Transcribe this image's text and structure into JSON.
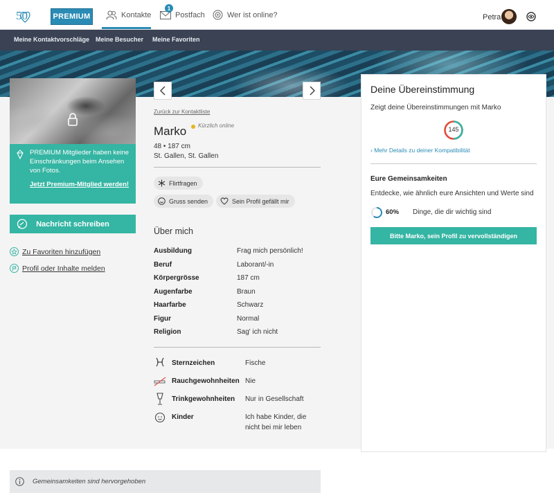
{
  "header": {
    "logo_text": "50",
    "premium_label": "PREMIUM",
    "tabs": [
      {
        "label": "Kontakte",
        "icon": "contacts-icon"
      },
      {
        "label": "Postfach",
        "icon": "mail-icon",
        "badge": "1"
      },
      {
        "label": "Wer ist online?",
        "icon": "online-icon"
      }
    ],
    "user_name": "Petra"
  },
  "subnav": {
    "items": [
      "Meine Kontaktvorschläge",
      "Meine Besucher",
      "Meine Favoriten"
    ]
  },
  "left": {
    "premium_text": "PREMIUM Mitglieder haben keine Einschränkungen beim Ansehen von Fotos.",
    "premium_link": "Jetzt Premium-Mitglied werden!",
    "message_button": "Nachricht schreiben",
    "favorites_link": "Zu Favoriten hinzufügen",
    "report_link": "Profil oder Inhalte melden"
  },
  "profile": {
    "back_link": "Zurück zur Kontaktliste",
    "name": "Marko",
    "online_status": "Kürzlich online",
    "age_height": "48 • 187 cm",
    "location": "St. Gallen, St. Gallen",
    "chips": {
      "flirt": "Flirtfragen",
      "greet": "Gruss senden",
      "like": "Sein Profil gefällt mir"
    },
    "about_title": "Über mich",
    "attributes": [
      {
        "key": "Ausbildung",
        "value": "Frag mich persönlich!"
      },
      {
        "key": "Beruf",
        "value": "Laborant/-in"
      },
      {
        "key": "Körpergrösse",
        "value": "187 cm"
      },
      {
        "key": "Augenfarbe",
        "value": "Braun"
      },
      {
        "key": "Haarfarbe",
        "value": "Schwarz"
      },
      {
        "key": "Figur",
        "value": "Normal"
      },
      {
        "key": "Religion",
        "value": "Sag' ich nicht"
      }
    ],
    "habits": [
      {
        "key": "Sternzeichen",
        "value": "Fische",
        "icon": "pisces-icon"
      },
      {
        "key": "Rauchgewohnheiten",
        "value": "Nie",
        "icon": "no-smoking-icon"
      },
      {
        "key": "Trinkgewohnheiten",
        "value": "Nur in Gesellschaft",
        "icon": "glass-icon"
      },
      {
        "key": "Kinder",
        "value": "Ich habe Kinder, die nicht bei mir leben",
        "icon": "child-icon"
      }
    ]
  },
  "match": {
    "title": "Deine Übereinstimmung",
    "subtitle": "Zeigt deine Übereinstimmungen mit Marko",
    "score": "145",
    "details_link": "› Mehr Details zu deiner Kompatibilität",
    "common_title": "Eure Gemeinsamkeiten",
    "common_text": "Entdecke, wie ähnlich eure Ansichten und Werte sind",
    "percent": "60%",
    "percent_value": 0.6,
    "percent_text": "Dinge, die dir wichtig sind",
    "button": "Bitte Marko, sein Profil zu vervollständigen"
  },
  "footer": {
    "info_text": "Gemeinsamkeiten sind hervorgehoben"
  },
  "colors": {
    "accent": "#35b5a3",
    "brand": "#2a8bb5",
    "subnav_bg": "#3a4254"
  }
}
